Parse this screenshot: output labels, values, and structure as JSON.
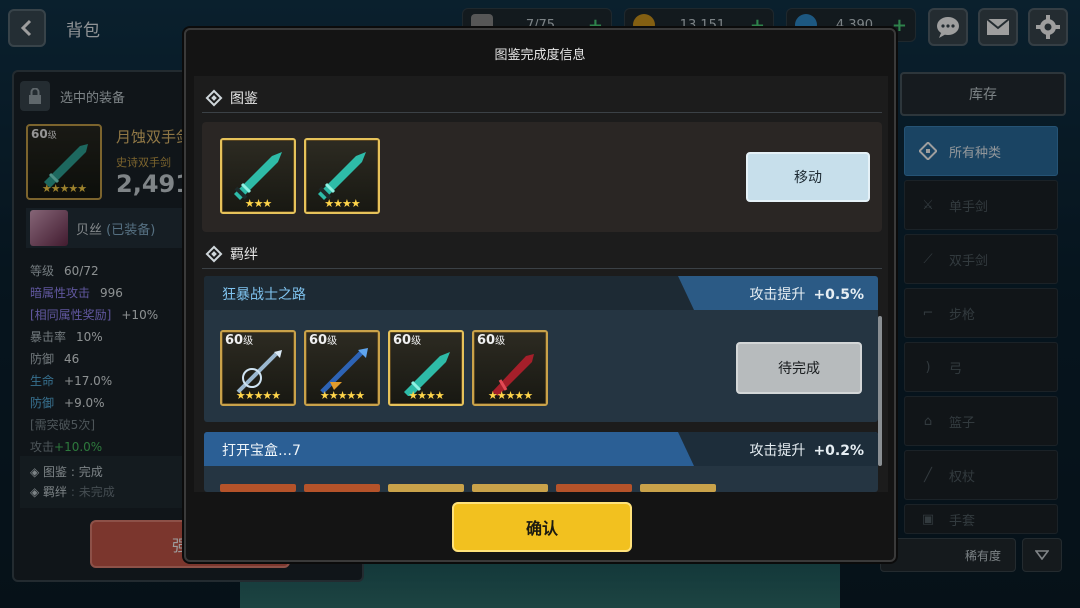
{
  "topbar": {
    "back": "back-icon",
    "title": "背包",
    "currencies": [
      {
        "icon": "stamina-icon",
        "value": "7/75"
      },
      {
        "icon": "gold-coin-icon",
        "value": "13,151"
      },
      {
        "icon": "gem-icon",
        "value": "4,390"
      }
    ],
    "actions": [
      "chat-icon",
      "mail-icon",
      "settings-icon"
    ]
  },
  "left_panel": {
    "header": "选中的装备",
    "item": {
      "level": "60",
      "level_unit": "级",
      "name": "月蚀双手剑",
      "type": "史诗双手剑",
      "power": "2,491",
      "stars": "★★★★★"
    },
    "owner": {
      "name": "贝丝",
      "status": "(已装备)"
    },
    "stats": [
      {
        "k": "等级",
        "v": "60/72",
        "style": ""
      },
      {
        "k": "暗属性攻击",
        "v": "996",
        "style": "hl"
      },
      {
        "k": "[相同属性奖励]",
        "v": "+10%",
        "style": "hl"
      },
      {
        "k": "暴击率",
        "v": "10%",
        "style": ""
      },
      {
        "k": "防御",
        "v": "46",
        "style": ""
      },
      {
        "k": "生命",
        "v": "+17.0%",
        "style": ""
      },
      {
        "k": "防御",
        "v": "+9.0%",
        "style": ""
      },
      {
        "k": "[需突破5次]",
        "v": "",
        "style": "grey"
      },
      {
        "k": "攻击",
        "v": "+10.0%",
        "style": "grey"
      }
    ],
    "footer": [
      {
        "k": "图鉴",
        "v": "完成"
      },
      {
        "k": "羁绊",
        "v": "未完成"
      }
    ],
    "action_button": "强"
  },
  "right_panel": {
    "tab": "库存",
    "categories": [
      {
        "label": "所有种类",
        "icon": "all-types-icon",
        "active": true
      },
      {
        "label": "单手剑",
        "icon": "sword-icon",
        "active": false
      },
      {
        "label": "双手剑",
        "icon": "greatsword-icon",
        "active": false
      },
      {
        "label": "步枪",
        "icon": "rifle-icon",
        "active": false
      },
      {
        "label": "弓",
        "icon": "bow-icon",
        "active": false
      },
      {
        "label": "篮子",
        "icon": "basket-icon",
        "active": false
      },
      {
        "label": "权杖",
        "icon": "staff-icon",
        "active": false
      },
      {
        "label": "手套",
        "icon": "glove-icon",
        "active": false
      }
    ],
    "sort_label": "稀有度",
    "sort_icon": "triangle-down-icon"
  },
  "modal": {
    "title": "图鉴完成度信息",
    "codex": {
      "heading": "图鉴",
      "items": [
        {
          "stars": "★★★"
        },
        {
          "stars": "★★★★"
        }
      ],
      "move_button": "移动"
    },
    "bonds": {
      "heading": "羁绊",
      "list": [
        {
          "name": "狂暴战士之路",
          "bonus_label": "攻击提升",
          "bonus_value": "+0.5%",
          "items": [
            {
              "level": "60",
              "unit": "级",
              "stars": "★★★★★",
              "weapon": "ice-staff",
              "lit": false
            },
            {
              "level": "60",
              "unit": "级",
              "stars": "★★★★★",
              "weapon": "blue-lance",
              "lit": false
            },
            {
              "level": "60",
              "unit": "级",
              "stars": "★★★★",
              "weapon": "eclipse-greatsword",
              "lit": true
            },
            {
              "level": "60",
              "unit": "级",
              "stars": "★★★★★",
              "weapon": "crimson-blade",
              "lit": false
            }
          ],
          "button": "待完成"
        },
        {
          "name": "打开宝盒…7",
          "bonus_label": "攻击提升",
          "bonus_value": "+0.2%"
        }
      ]
    },
    "confirm": "确认"
  }
}
